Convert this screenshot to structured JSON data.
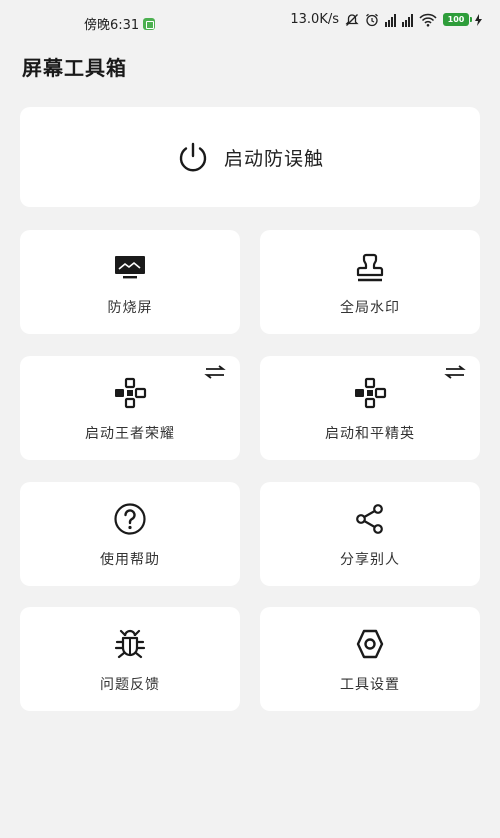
{
  "status_bar": {
    "time": "傍晚6:31",
    "net_speed": "13.0K/s",
    "battery": "100"
  },
  "app_title": "屏幕工具箱",
  "hero": {
    "label": "启动防误触",
    "icon": "power-icon"
  },
  "tiles": [
    {
      "label": "防烧屏",
      "icon": "monitor-icon"
    },
    {
      "label": "全局水印",
      "icon": "stamp-icon"
    },
    {
      "label": "启动王者荣耀",
      "icon": "gamepad-icon"
    },
    {
      "label": "启动和平精英",
      "icon": "gamepad-icon"
    },
    {
      "label": "使用帮助",
      "icon": "question-icon"
    },
    {
      "label": "分享别人",
      "icon": "share-icon"
    },
    {
      "label": "问题反馈",
      "icon": "bug-icon"
    },
    {
      "label": "工具设置",
      "icon": "settings-icon"
    }
  ]
}
